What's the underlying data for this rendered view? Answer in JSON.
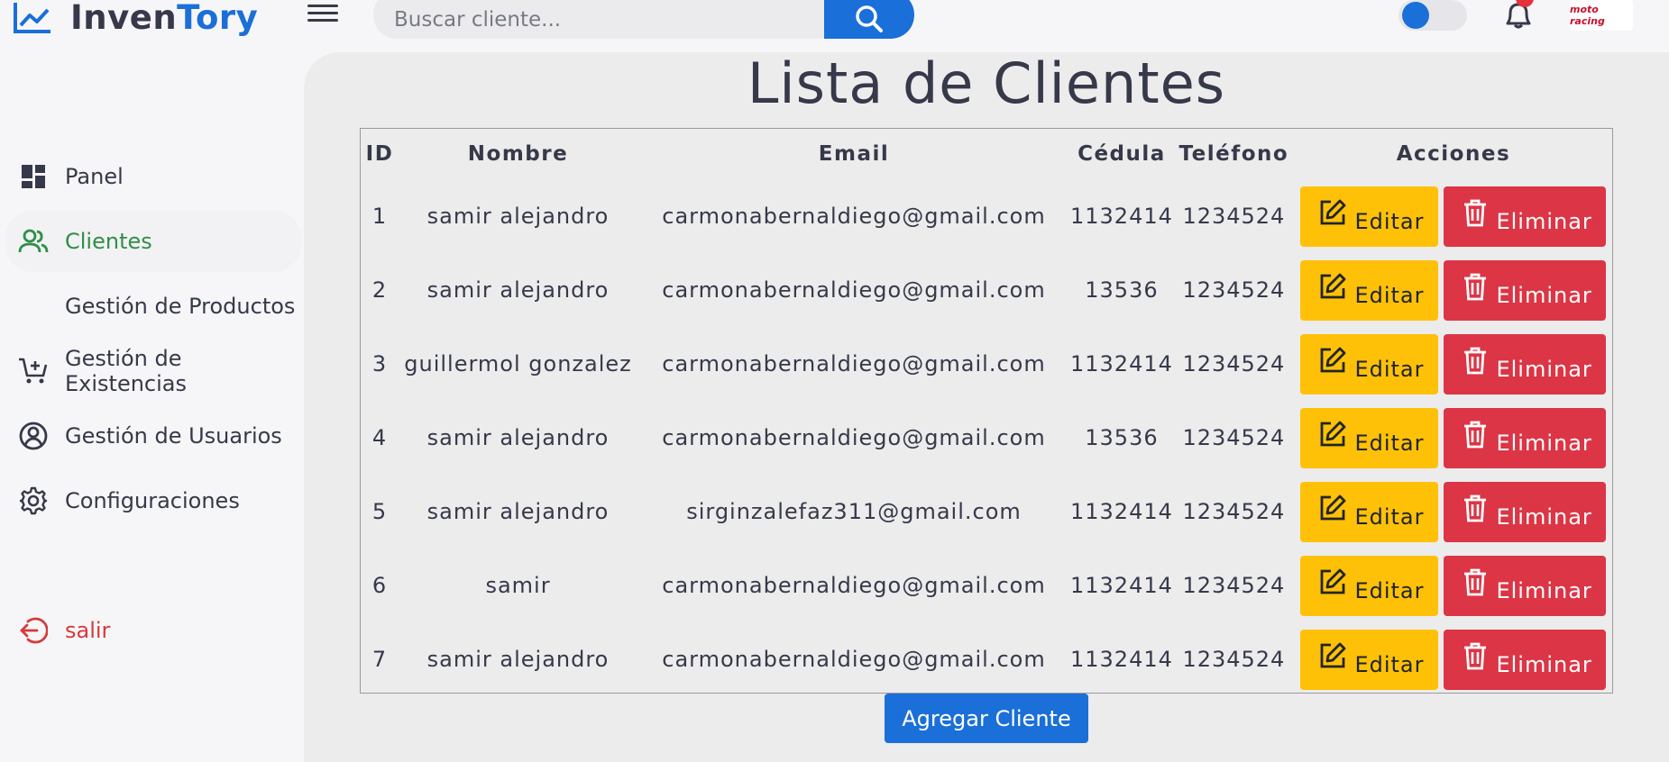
{
  "header": {
    "logo_part1": "Inven",
    "logo_part2": "Tory",
    "search_placeholder": "Buscar cliente...",
    "avatar_text": "moto racing"
  },
  "sidebar": {
    "items": [
      {
        "label": "Panel",
        "icon": "dashboard-icon"
      },
      {
        "label": "Clientes",
        "icon": "users-icon"
      },
      {
        "label": "Gestión de Productos",
        "icon": ""
      },
      {
        "label": "Gestión de Existencias",
        "icon": "cart-plus-icon"
      },
      {
        "label": "Gestión de Usuarios",
        "icon": "user-circle-icon"
      },
      {
        "label": "Configuraciones",
        "icon": "gear-icon"
      }
    ],
    "logout": "salir"
  },
  "main": {
    "title": "Lista de Clientes",
    "columns": [
      "ID",
      "Nombre",
      "Email",
      "Cédula",
      "Teléfono",
      "Acciones"
    ],
    "rows": [
      {
        "id": "1",
        "nombre": "samir alejandro",
        "email": "carmonabernaldiego@gmail.com",
        "cedula": "1132414",
        "telefono": "1234524"
      },
      {
        "id": "2",
        "nombre": "samir alejandro",
        "email": "carmonabernaldiego@gmail.com",
        "cedula": "13536",
        "telefono": "1234524"
      },
      {
        "id": "3",
        "nombre": "guillermol gonzalez",
        "email": "carmonabernaldiego@gmail.com",
        "cedula": "1132414",
        "telefono": "1234524"
      },
      {
        "id": "4",
        "nombre": "samir alejandro",
        "email": "carmonabernaldiego@gmail.com",
        "cedula": "13536",
        "telefono": "1234524"
      },
      {
        "id": "5",
        "nombre": "samir alejandro",
        "email": "sirginzalefaz311@gmail.com",
        "cedula": "1132414",
        "telefono": "1234524"
      },
      {
        "id": "6",
        "nombre": "samir",
        "email": "carmonabernaldiego@gmail.com",
        "cedula": "1132414",
        "telefono": "1234524"
      },
      {
        "id": "7",
        "nombre": "samir alejandro",
        "email": "carmonabernaldiego@gmail.com",
        "cedula": "1132414",
        "telefono": "1234524"
      }
    ],
    "edit_label": "Editar",
    "delete_label": "Eliminar",
    "add_label": "Agregar Cliente"
  },
  "colors": {
    "accent": "#1b6fd8",
    "active": "#2f8f48",
    "edit": "#ffc107",
    "delete": "#dc3545",
    "logout": "#d63a3a"
  }
}
